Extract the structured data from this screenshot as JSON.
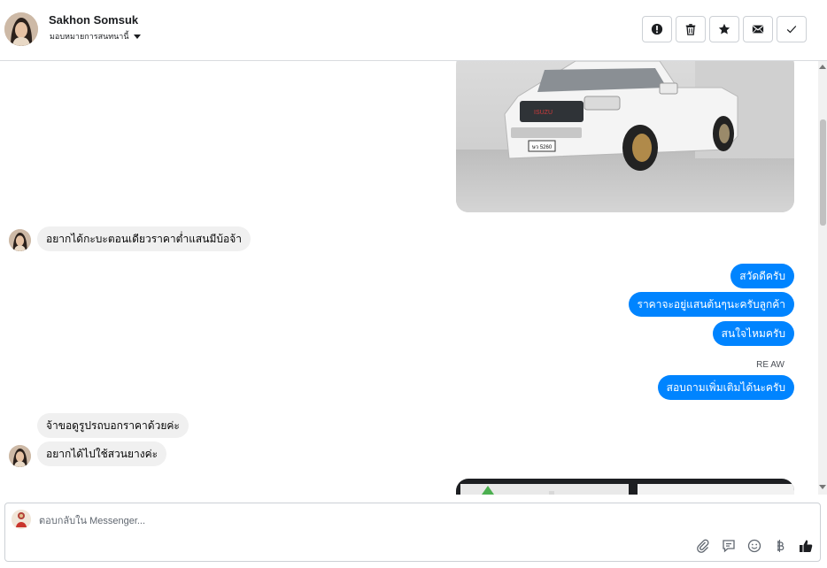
{
  "header": {
    "contact_name": "Sakhon Somsuk",
    "assign_label": "มอบหมายการสนทนานี้",
    "actions": [
      {
        "name": "mark-spam-button",
        "icon": "alert-circle-icon"
      },
      {
        "name": "delete-button",
        "icon": "trash-icon"
      },
      {
        "name": "star-button",
        "icon": "star-icon"
      },
      {
        "name": "mark-unread-button",
        "icon": "envelope-icon"
      },
      {
        "name": "mark-done-button",
        "icon": "check-icon"
      }
    ]
  },
  "messages": {
    "image1_alt": "white pickup truck photo",
    "m1": "อยากได้กะบะตอนเดียวราคาต่ำแสนมีบ้อจ้า",
    "r1": "สวัดดีครับ",
    "r2": "ราคาจะอยู่แสนต้นๆนะครับลูกค้า",
    "r3": "สนใจไหมครับ",
    "sender_label": "RE AW",
    "r4": "สอบถามเพิ่มเติมได้นะครับ",
    "m2": "จ้าขอดูรูปรถบอกราคาด้วยค่ะ",
    "m3": "อยากได้ไปใช้สวนยางค่ะ",
    "plate_text": "ษว 5260"
  },
  "composer": {
    "placeholder": "ตอบกลับใน Messenger...",
    "tools": [
      "paperclip-icon",
      "saved-reply-icon",
      "emoji-icon",
      "baht-icon",
      "thumbs-up-icon"
    ]
  },
  "colors": {
    "outgoing_bubble": "#0084ff",
    "incoming_bubble": "#f0f0f0",
    "like_icon": "#1c1e21"
  }
}
